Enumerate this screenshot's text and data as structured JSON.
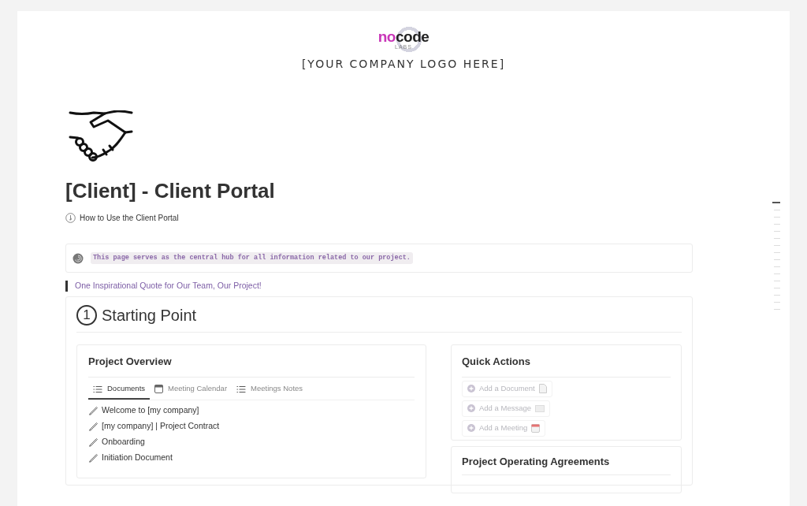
{
  "logo": {
    "wordmark_start": "no",
    "wordmark_end": "code",
    "subtitle": "LABS",
    "caption": "[YOUR COMPANY LOGO HERE]"
  },
  "page": {
    "title": "[Client] - Client Portal",
    "link": "How to Use the Client Portal"
  },
  "callout": {
    "text": "This page serves as the central hub for all information related to our project."
  },
  "quote": {
    "text": "One Inspirational Quote for Our Team, Our Project!"
  },
  "section": {
    "number": "1",
    "title": "Starting Point"
  },
  "overview": {
    "title": "Project Overview",
    "tabs": [
      {
        "label": "Documents",
        "kind": "list",
        "selected": true
      },
      {
        "label": "Meeting Calendar",
        "kind": "calendar",
        "selected": false
      },
      {
        "label": "Meetings Notes",
        "kind": "list",
        "selected": false
      }
    ],
    "documents": [
      "Welcome to [my company]",
      "[my company] | Project Contract",
      "Onboarding",
      "Initiation Document"
    ]
  },
  "quick_actions": {
    "title": "Quick Actions",
    "items": [
      {
        "label": "Add a Document",
        "kind": "document"
      },
      {
        "label": "Add a Message",
        "kind": "message"
      },
      {
        "label": "Add a Meeting",
        "kind": "calendar"
      }
    ]
  },
  "agreements": {
    "title": "Project Operating Agreements"
  },
  "outline": [
    {
      "selected": true
    },
    {
      "selected": false
    },
    {
      "selected": false
    },
    {
      "selected": false
    },
    {
      "selected": false
    },
    {
      "selected": false
    },
    {
      "selected": false
    },
    {
      "selected": false
    },
    {
      "selected": false
    },
    {
      "selected": false
    },
    {
      "selected": false
    },
    {
      "selected": false
    },
    {
      "selected": false
    },
    {
      "selected": false
    },
    {
      "selected": false
    },
    {
      "selected": false
    }
  ]
}
